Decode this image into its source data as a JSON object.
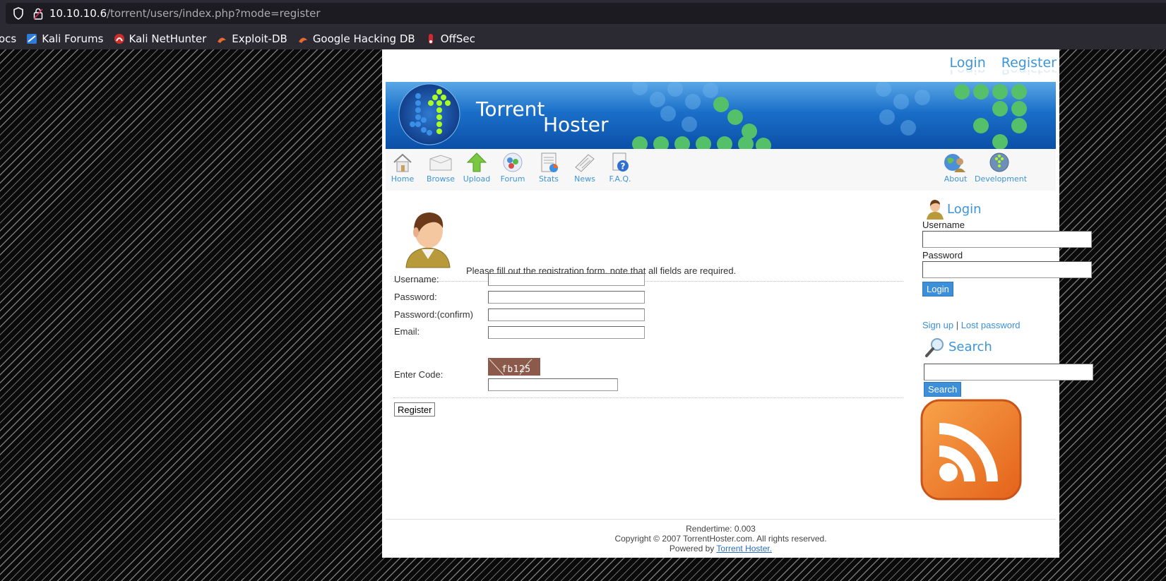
{
  "browser": {
    "url_host": "10.10.10.6",
    "url_path": "/torrent/users/index.php?mode=register",
    "bookmarks": [
      {
        "label": "ocs",
        "icon": "none"
      },
      {
        "label": "Kali Forums",
        "icon": "kali-forums-icon"
      },
      {
        "label": "Kali NetHunter",
        "icon": "kali-nethunter-icon"
      },
      {
        "label": "Exploit-DB",
        "icon": "exploit-db-icon"
      },
      {
        "label": "Google Hacking DB",
        "icon": "ghdb-icon"
      },
      {
        "label": "OffSec",
        "icon": "offsec-icon"
      }
    ]
  },
  "header": {
    "login_link": "Login",
    "register_link": "Register",
    "banner_title_1": "Torrent",
    "banner_title_2": "Hoster"
  },
  "nav": {
    "items": [
      {
        "label": "Home",
        "icon": "home-icon"
      },
      {
        "label": "Browse",
        "icon": "browse-icon"
      },
      {
        "label": "Upload",
        "icon": "upload-icon"
      },
      {
        "label": "Forum",
        "icon": "forum-icon"
      },
      {
        "label": "Stats",
        "icon": "stats-icon"
      },
      {
        "label": "News",
        "icon": "news-icon"
      },
      {
        "label": "F.A.Q.",
        "icon": "faq-icon"
      }
    ],
    "right_items": [
      {
        "label": "About",
        "icon": "about-icon"
      },
      {
        "label": "Development",
        "icon": "development-icon"
      }
    ]
  },
  "register": {
    "intro": "Please fill out the registration form, note that all fields are required.",
    "username_label": "Username:",
    "password_label": "Password:",
    "password_confirm_label": "Password:(confirm)",
    "email_label": "Email:",
    "code_label": "Enter Code:",
    "captcha_text": "fb125",
    "submit_label": "Register"
  },
  "sidebar": {
    "login_heading": "Login",
    "username_label": "Username",
    "password_label": "Password",
    "login_button": "Login",
    "signup_link": "Sign up",
    "separator": " | ",
    "lost_password_link": "Lost password",
    "search_heading": "Search",
    "search_button": "Search"
  },
  "footer": {
    "rendertime": "Rendertime: 0.003",
    "copyright": "Copyright © 2007 TorrentHoster.com. All rights reserved.",
    "powered_prefix": "Powered by ",
    "powered_link": "Torrent Hoster."
  },
  "colors": {
    "link": "#3c95d9",
    "banner_dark": "#0b4fa8",
    "banner_light": "#5aa7e6",
    "captcha_bg": "#8b5a4a",
    "rss_orange": "#f07a24"
  }
}
